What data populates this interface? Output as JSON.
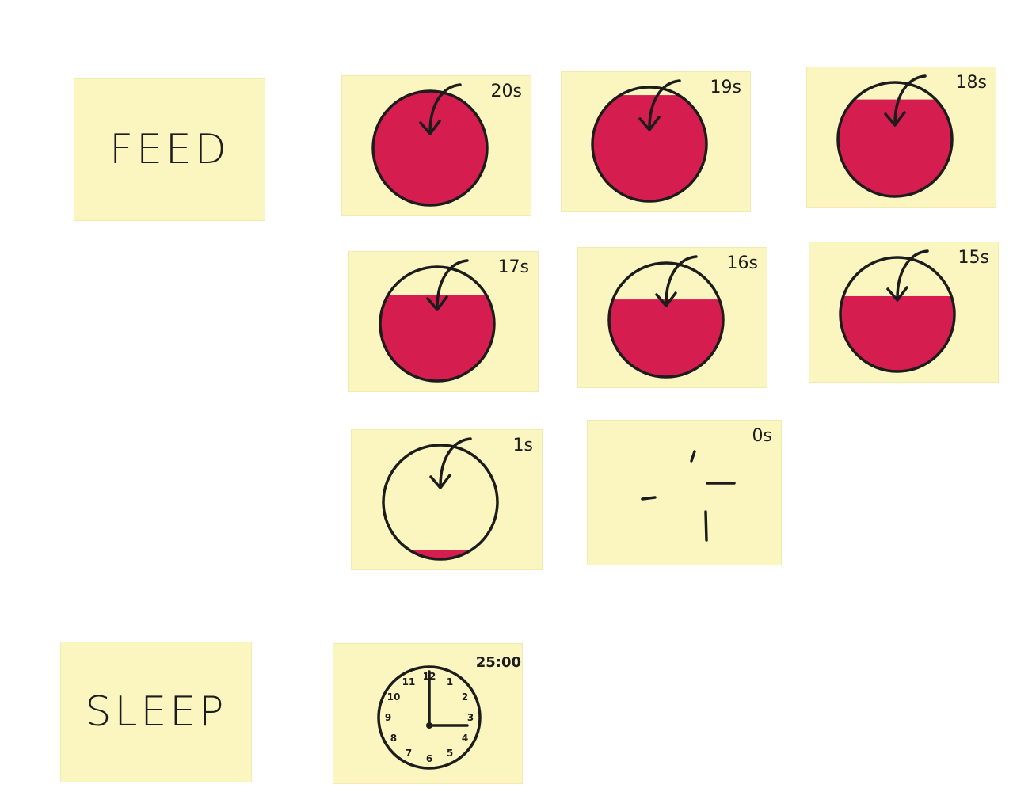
{
  "feed": {
    "label": "FEED",
    "frames": [
      {
        "time": "20s",
        "fill_level": 1.0
      },
      {
        "time": "19s",
        "fill_level": 0.93
      },
      {
        "time": "18s",
        "fill_level": 0.85
      },
      {
        "time": "17s",
        "fill_level": 0.75
      },
      {
        "time": "16s",
        "fill_level": 0.68
      },
      {
        "time": "15s",
        "fill_level": 0.66
      },
      {
        "time": "1s",
        "fill_level": 0.08
      },
      {
        "time": "0s",
        "fill_level": 0.0
      }
    ]
  },
  "sleep": {
    "label": "SLEEP",
    "frame": {
      "time": "25:00",
      "clock_numbers": [
        "12",
        "1",
        "2",
        "3",
        "4",
        "5",
        "6",
        "7",
        "8",
        "9",
        "10",
        "11"
      ]
    }
  },
  "colors": {
    "note": "#fbf6c0",
    "juice": "#d51e4f",
    "ink": "#1c1c1c"
  }
}
